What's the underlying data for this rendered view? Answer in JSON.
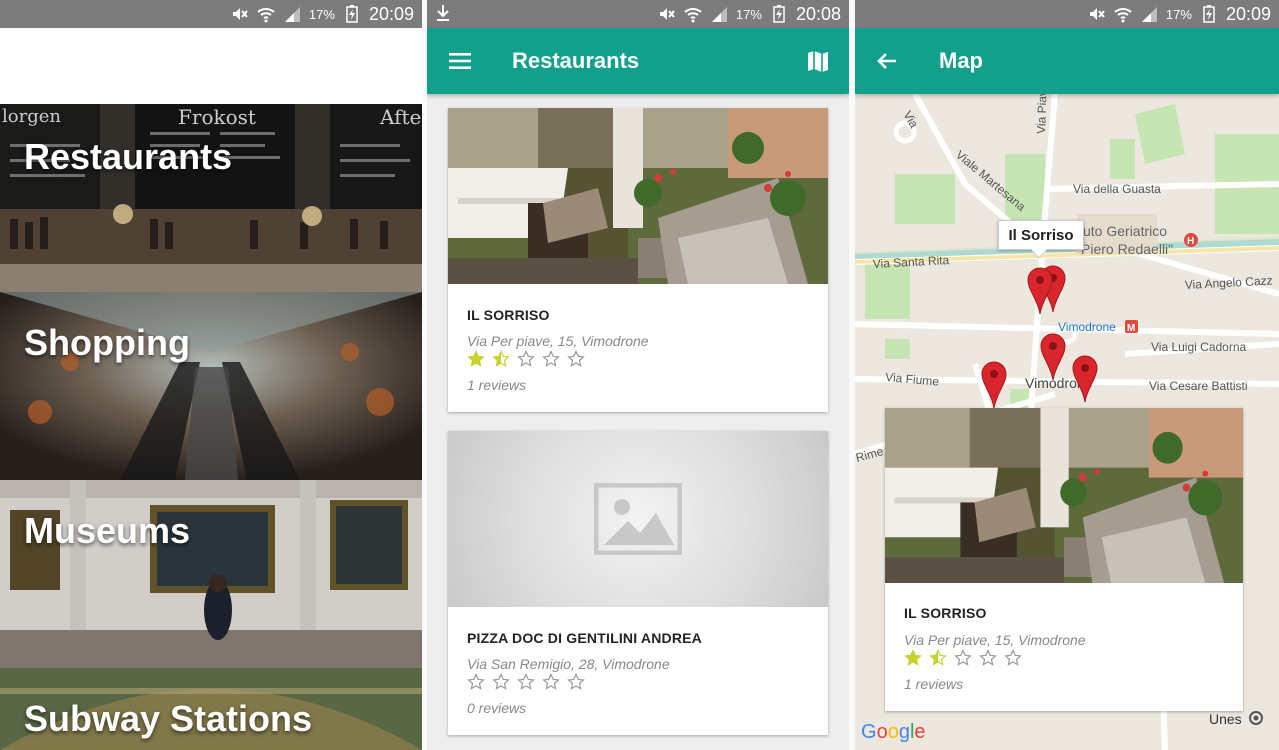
{
  "status": {
    "screen1": {
      "battery": "17%",
      "time": "20:09"
    },
    "screen2": {
      "battery": "17%",
      "time": "20:08"
    },
    "screen3": {
      "battery": "17%",
      "time": "20:09"
    }
  },
  "categories": [
    {
      "label": "Restaurants"
    },
    {
      "label": "Shopping"
    },
    {
      "label": "Museums"
    },
    {
      "label": "Subway Stations"
    }
  ],
  "restaurants_screen": {
    "title": "Restaurants",
    "cards": [
      {
        "name": "IL SORRISO",
        "address": "Via Per piave, 15, Vimodrone",
        "rating": 1.5,
        "reviews": "1 reviews"
      },
      {
        "name": "PIZZA DOC DI GENTILINI ANDREA",
        "address": "Via San Remigio, 28, Vimodrone",
        "rating": 0,
        "reviews": "0 reviews"
      }
    ]
  },
  "map_screen": {
    "title": "Map",
    "info_window": "Il Sorriso",
    "street_labels": {
      "via_piave": "Via Piave",
      "viale_martesana": "Viale Martesana",
      "via_della_guasta": "Via della Guasta",
      "via_santa_rita": "Via Santa Rita",
      "via_angelo_cazzaniga": "Via Angelo Cazz",
      "vimodrone_station": "Vimodrone",
      "via_luigi_cadorna": "Via Luigi Cadorna",
      "via_fiume": "Via Fiume",
      "vimodrone": "Vimodrone",
      "via_cesare_battisti": "Via Cesare Battisti",
      "istituto_line1": "uto Geriatrico",
      "istituto_line2": "Piero Redaelli\"",
      "via_rime": "Rime",
      "unes": "Unes",
      "via_top": "Via"
    },
    "google_logo": "Google",
    "card": {
      "name": "IL SORRISO",
      "address": "Via Per piave, 15, Vimodrone",
      "rating": 1.5,
      "reviews": "1 reviews"
    }
  },
  "colors": {
    "primary": "#12a08c",
    "star": "#c6d22e",
    "marker": "#d9252b"
  }
}
